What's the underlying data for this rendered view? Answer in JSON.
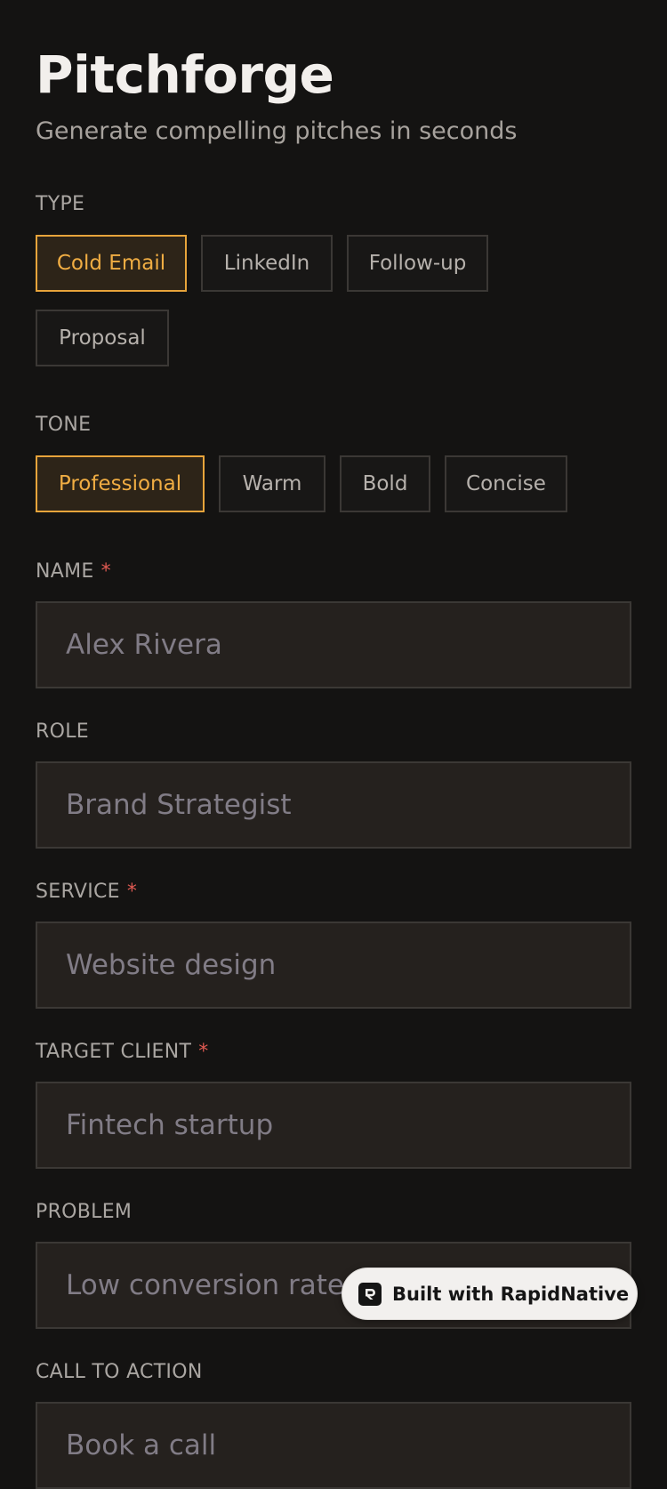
{
  "app": {
    "title": "Pitchforge",
    "subtitle": "Generate compelling pitches in seconds"
  },
  "type_section": {
    "label": "TYPE",
    "options": [
      "Cold Email",
      "LinkedIn",
      "Follow-up",
      "Proposal"
    ],
    "selected": "Cold Email"
  },
  "tone_section": {
    "label": "TONE",
    "options": [
      "Professional",
      "Warm",
      "Bold",
      "Concise"
    ],
    "selected": "Professional"
  },
  "fields": {
    "name": {
      "label": "NAME",
      "required_mark": "*",
      "value": "",
      "placeholder": "Alex Rivera"
    },
    "role": {
      "label": "ROLE",
      "value": "",
      "placeholder": "Brand Strategist"
    },
    "service": {
      "label": "SERVICE",
      "required_mark": "*",
      "value": "",
      "placeholder": "Website design"
    },
    "target_client": {
      "label": "TARGET CLIENT",
      "required_mark": "*",
      "value": "",
      "placeholder": "Fintech startup"
    },
    "problem": {
      "label": "PROBLEM",
      "value": "",
      "placeholder": "Low conversion rates"
    },
    "call_to_action": {
      "label": "CALL TO ACTION",
      "value": "",
      "placeholder": "Book a call"
    }
  },
  "badge": {
    "text": "Built with RapidNative",
    "icon": "rapidnative-logo-icon"
  },
  "colors": {
    "background": "#141312",
    "accent": "#f0ad43",
    "required": "#e05a52",
    "field_background": "#25211e"
  }
}
